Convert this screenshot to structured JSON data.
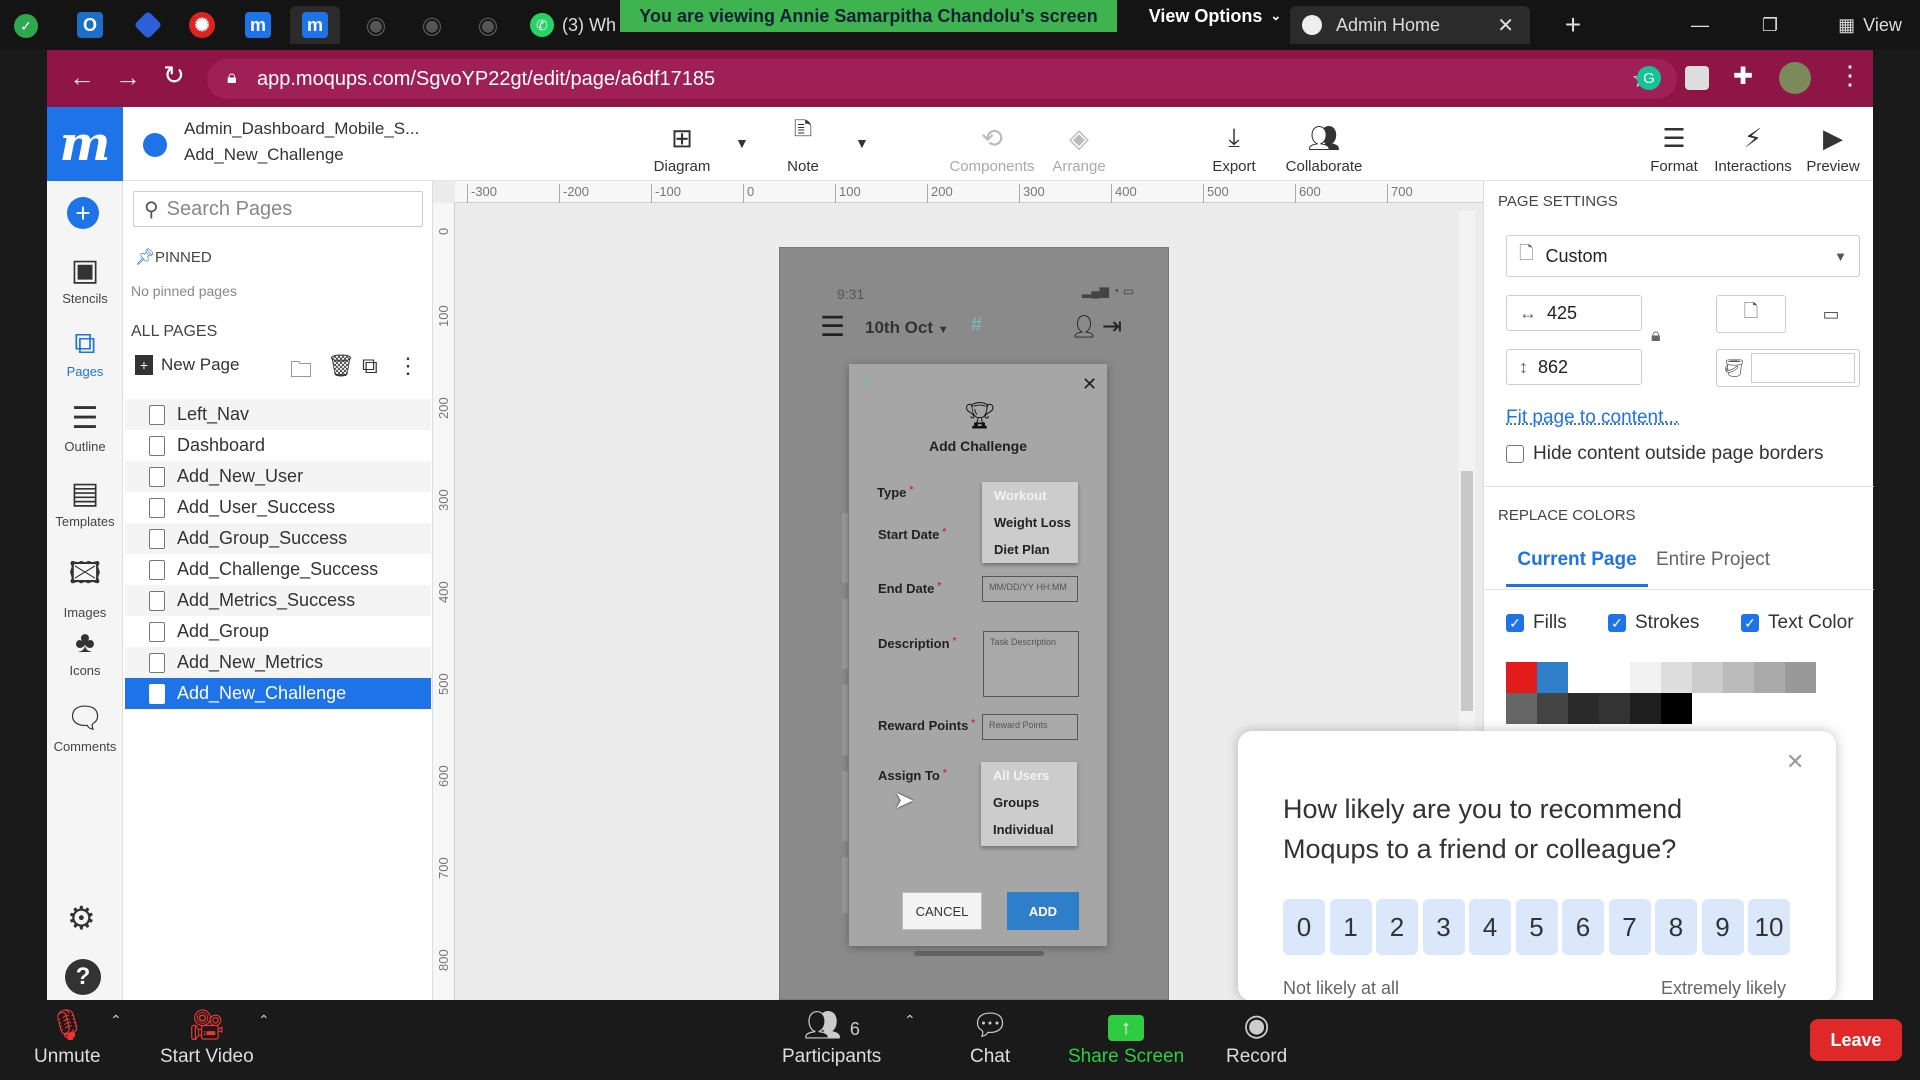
{
  "browser": {
    "tabs": [
      {
        "label": "(3) Wh",
        "icon": "whatsapp-icon"
      },
      {
        "label": "Admin Home",
        "icon": "globe-icon"
      }
    ],
    "url": "app.moqups.com/SgvoYP22gt/edit/page/a6df17185",
    "share_banner": "You are viewing Annie Samarpitha Chandolu's screen",
    "view_options": "View Options",
    "view_label": "View"
  },
  "app": {
    "project_name": "Admin_Dashboard_Mobile_S...",
    "page_name": "Add_New_Challenge",
    "toolbar": {
      "diagram": "Diagram",
      "note": "Note",
      "components": "Components",
      "arrange": "Arrange",
      "export": "Export",
      "collaborate": "Collaborate",
      "format": "Format",
      "interactions": "Interactions",
      "preview": "Preview"
    },
    "rail": {
      "stencils": "Stencils",
      "pages": "Pages",
      "outline": "Outline",
      "templates": "Templates",
      "images": "Images",
      "icons": "Icons",
      "comments": "Comments"
    },
    "pages_panel": {
      "search_placeholder": "Search Pages",
      "pinned_label": "PINNED",
      "no_pinned": "No pinned pages",
      "all_pages_label": "ALL PAGES",
      "new_page": "New Page",
      "pages": [
        "Left_Nav",
        "Dashboard",
        "Add_New_User",
        "Add_User_Success",
        "Add_Group_Success",
        "Add_Challenge_Success",
        "Add_Metrics_Success",
        "Add_Group",
        "Add_New_Metrics",
        "Add_New_Challenge"
      ],
      "selected_page": "Add_New_Challenge"
    },
    "ruler": {
      "top": [
        "-300",
        "-200",
        "-100",
        "0",
        "100",
        "200",
        "300",
        "400",
        "500",
        "600",
        "700"
      ],
      "left": [
        "0",
        "100",
        "200",
        "300",
        "400",
        "500",
        "600",
        "700",
        "800"
      ]
    },
    "mockup": {
      "time": "9:31",
      "date_label": "10th Oct",
      "modal_title": "Add Challenge",
      "labels": {
        "type": "Type",
        "start_date": "Start Date",
        "end_date": "End Date",
        "description": "Description",
        "reward_points": "Reward Points",
        "assign_to": "Assign To"
      },
      "type_options": [
        "Workout",
        "Weight Loss",
        "Diet Plan"
      ],
      "end_date_placeholder": "MM/DD/YY HH:MM",
      "description_placeholder": "Task Description",
      "reward_placeholder": "Reward Points",
      "assign_options": [
        "All Users",
        "Groups",
        "Individual"
      ],
      "cancel": "CANCEL",
      "add": "ADD"
    },
    "right_panel": {
      "page_settings": "PAGE SETTINGS",
      "size_preset": "Custom",
      "width": "425",
      "height": "862",
      "fit_link": "Fit page to content...",
      "hide_outside": "Hide content outside page borders",
      "replace_colors": "REPLACE COLORS",
      "tab_current": "Current Page",
      "tab_entire": "Entire Project",
      "fills": "Fills",
      "strokes": "Strokes",
      "text_color": "Text Color",
      "swatches_row1": [
        "#e31b1b",
        "#2f7ec9",
        "#ffffff",
        "#ffffff",
        "#f2f2f2",
        "#dddddd",
        "#cccccc",
        "#bbbbbb",
        "#aaaaaa",
        "#999999"
      ],
      "swatches_row2": [
        "#666666",
        "#444444",
        "#2a2a2a",
        "#333333",
        "#1e1e1e",
        "#000000"
      ]
    },
    "survey": {
      "question": "How likely are you to recommend Moqups to a friend or colleague?",
      "scale": [
        "0",
        "1",
        "2",
        "3",
        "4",
        "5",
        "6",
        "7",
        "8",
        "9",
        "10"
      ],
      "low_label": "Not likely at all",
      "high_label": "Extremely likely"
    }
  },
  "zoom": {
    "unmute": "Unmute",
    "start_video": "Start Video",
    "participants": "Participants",
    "participants_count": "6",
    "chat": "Chat",
    "share_screen": "Share Screen",
    "record": "Record",
    "leave": "Leave"
  }
}
